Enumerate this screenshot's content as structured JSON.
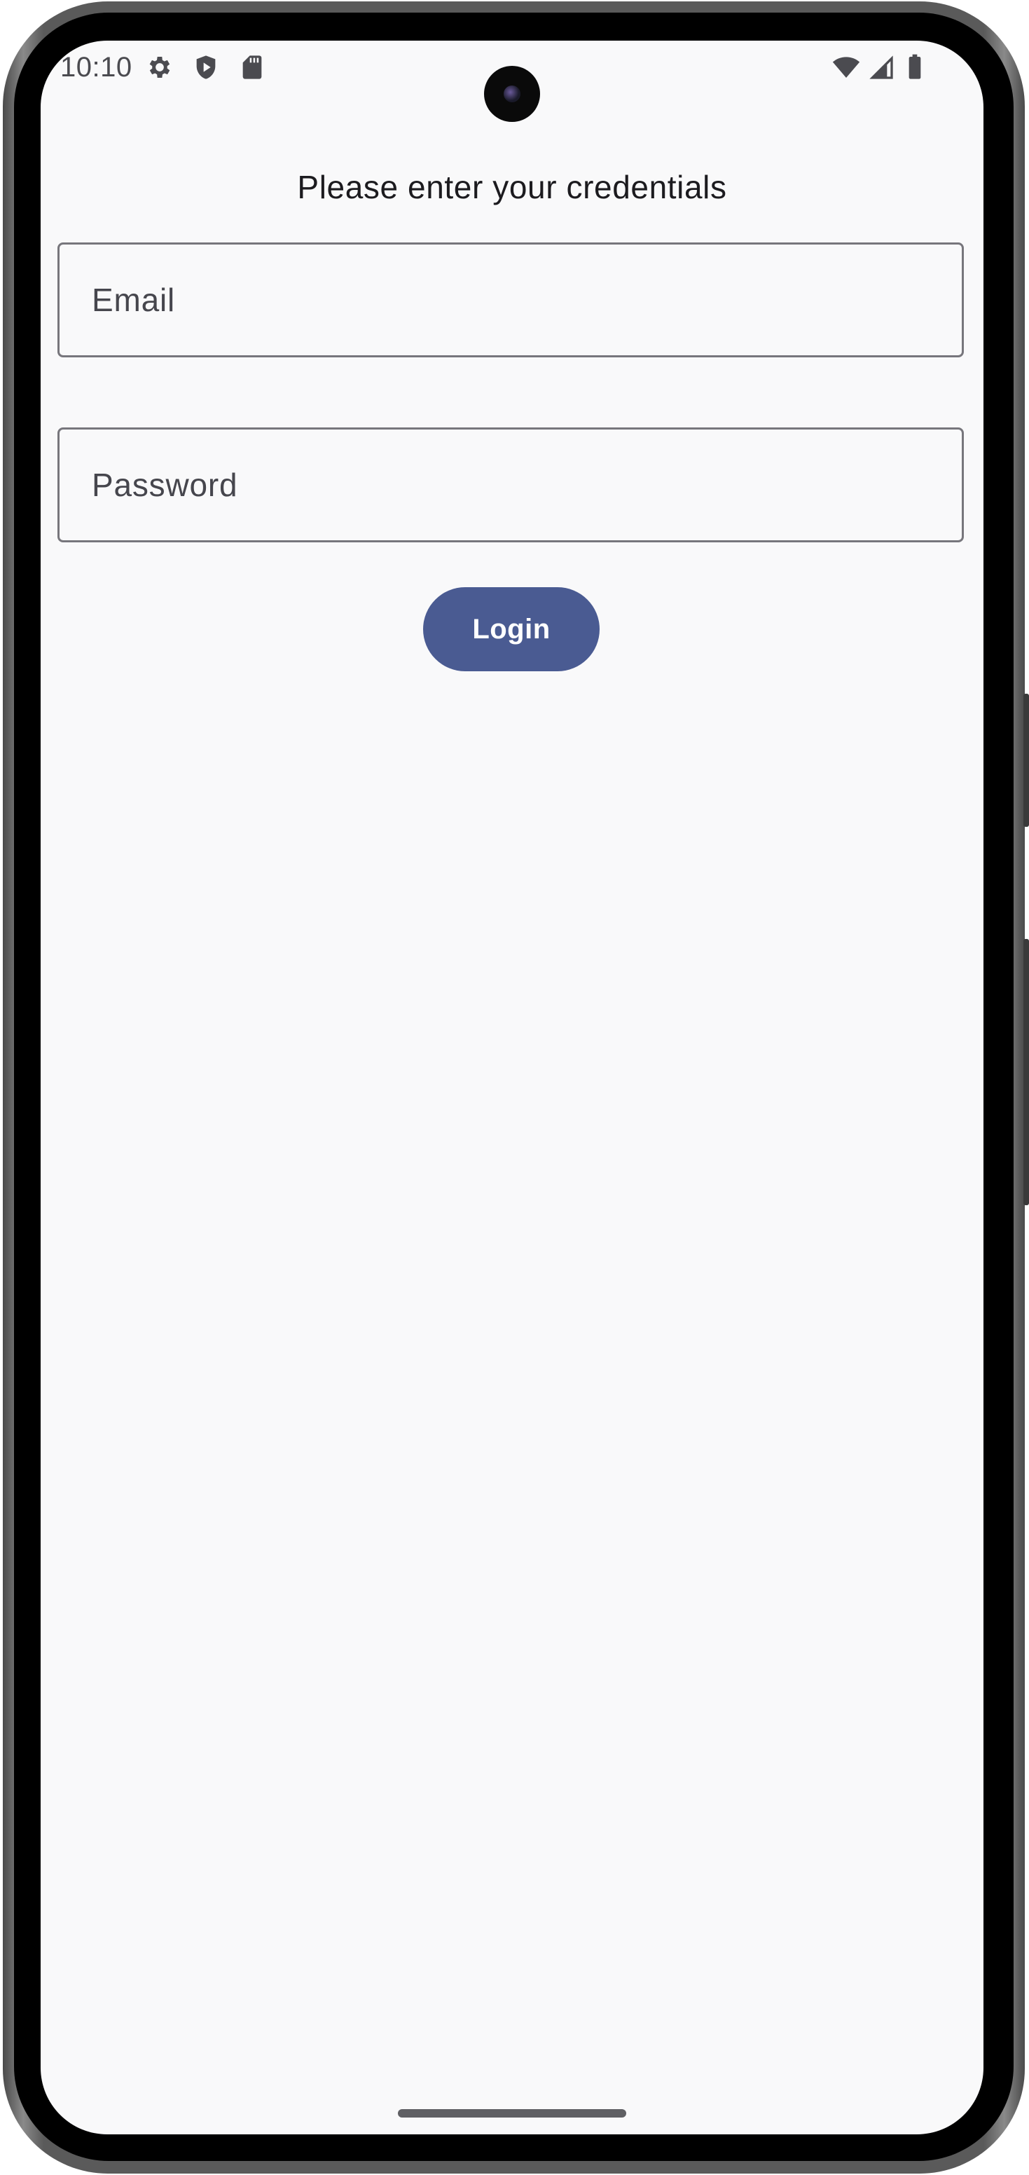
{
  "status_bar": {
    "time": "10:10",
    "icons": [
      "gear-icon",
      "shield-play-icon",
      "sd-card-icon",
      "wifi-icon",
      "cellular-signal-icon",
      "battery-icon"
    ]
  },
  "login_screen": {
    "heading": "Please enter your credentials",
    "email_field": {
      "placeholder": "Email",
      "value": ""
    },
    "password_field": {
      "placeholder": "Password",
      "value": ""
    },
    "login_button": {
      "label": "Login"
    }
  },
  "colors": {
    "background": "#f9f9fa",
    "button": "#4a5b92",
    "button_text": "#ffffff",
    "field_border": "#77767c",
    "heading_text": "#1c1b1f",
    "placeholder_text": "#46464d"
  }
}
